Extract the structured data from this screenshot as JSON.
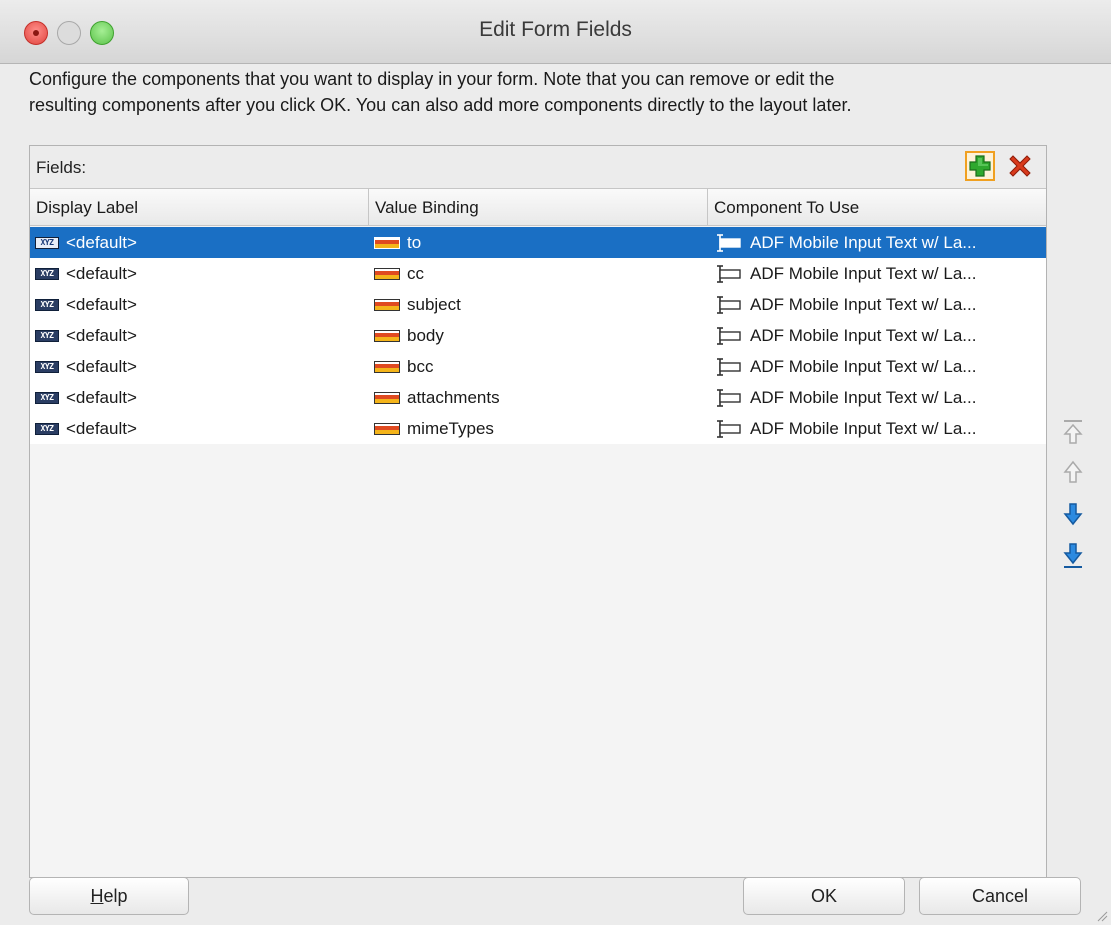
{
  "window": {
    "title": "Edit Form Fields"
  },
  "description": {
    "line1": "Configure the components that you want to display in your form.  Note that you can remove or edit the",
    "line2": "resulting components after you click OK.  You can also add more components directly to the layout later."
  },
  "fields": {
    "label": "Fields:",
    "add_icon": "add-icon",
    "remove_icon": "remove-icon",
    "columns": [
      "Display Label",
      "Value Binding",
      "Component To Use"
    ],
    "rows": [
      {
        "display_label": "<default>",
        "value_binding": "to",
        "component": "ADF Mobile Input Text w/ La...",
        "selected": true
      },
      {
        "display_label": "<default>",
        "value_binding": "cc",
        "component": "ADF Mobile Input Text w/ La...",
        "selected": false
      },
      {
        "display_label": "<default>",
        "value_binding": "subject",
        "component": "ADF Mobile Input Text w/ La...",
        "selected": false
      },
      {
        "display_label": "<default>",
        "value_binding": "body",
        "component": "ADF Mobile Input Text w/ La...",
        "selected": false
      },
      {
        "display_label": "<default>",
        "value_binding": "bcc",
        "component": "ADF Mobile Input Text w/ La...",
        "selected": false
      },
      {
        "display_label": "<default>",
        "value_binding": "attachments",
        "component": "ADF Mobile Input Text w/ La...",
        "selected": false
      },
      {
        "display_label": "<default>",
        "value_binding": "mimeTypes",
        "component": "ADF Mobile Input Text w/ La...",
        "selected": false
      }
    ]
  },
  "side_buttons": [
    "move-to-top-icon",
    "move-up-icon",
    "move-down-icon",
    "move-to-bottom-icon"
  ],
  "buttons": {
    "help": "Help",
    "ok": "OK",
    "cancel": "Cancel"
  },
  "colors": {
    "selection": "#1a6fc4",
    "add_green": "#2ea82e",
    "remove_red": "#d83a1c",
    "arrow_blue": "#2c8ae0"
  }
}
